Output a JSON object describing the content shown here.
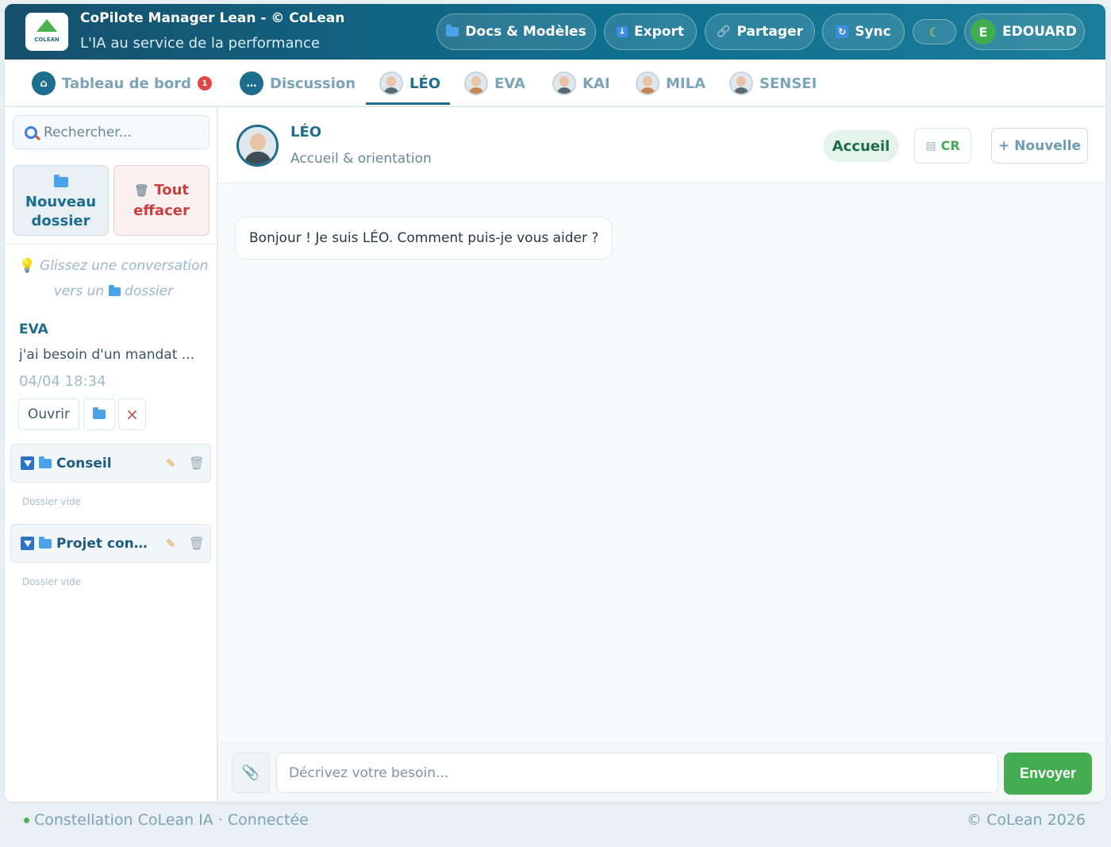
{
  "header": {
    "logo_text": "COLEAN",
    "title": "CoPilote Manager Lean - © CoLean",
    "subtitle": "L'IA au service de la performance",
    "buttons": {
      "docs": "Docs & Modèles",
      "export": "Export",
      "share": "Partager",
      "sync": "Sync",
      "theme_icon": "moon-icon",
      "user_initial": "E",
      "user_name": "EDOUARD"
    }
  },
  "tabs": [
    {
      "label": "Tableau de bord",
      "badge": "1",
      "icon": "home-icon"
    },
    {
      "label": "Discussion",
      "icon": "chat-bubble-icon"
    },
    {
      "label": "LÉO",
      "icon": "avatar",
      "active": true
    },
    {
      "label": "EVA",
      "icon": "avatar"
    },
    {
      "label": "KAI",
      "icon": "avatar"
    },
    {
      "label": "MILA",
      "icon": "avatar"
    },
    {
      "label": "SENSEI",
      "icon": "avatar"
    }
  ],
  "sidebar": {
    "search_placeholder": "Rechercher...",
    "new_folder": "Nouveau dossier",
    "clear_all": "Tout effacer",
    "hint_part1": "Glissez une conversation vers un",
    "hint_part2": "dossier",
    "conversation": {
      "agent": "EVA",
      "snippet": "j'ai besoin d'un mandat ...",
      "date": "04/04 18:34",
      "open": "Ouvrir"
    },
    "folders": [
      {
        "name": "Conseil",
        "empty": "Dossier vide"
      },
      {
        "name": "Projet conc...",
        "empty": "Dossier vide"
      }
    ]
  },
  "chat": {
    "agent_name": "LÉO",
    "agent_role": "Accueil & orientation",
    "mode_pill": "Accueil",
    "cr_label": "CR",
    "new_label": "+ Nouvelle",
    "messages": [
      {
        "from": "LÉO",
        "text": "Bonjour ! Je suis LÉO. Comment puis-je vous aider ?"
      }
    ],
    "input_placeholder": "Décrivez votre besoin...",
    "send_label": "Envoyer"
  },
  "footer": {
    "status": "Constellation CoLean IA · Connectée",
    "copyright": "© CoLean 2026"
  },
  "colors": {
    "header_gradient_start": "#16506d",
    "accent": "#1c6d8e",
    "send_green": "#44ad52",
    "badge_red": "#e04848",
    "danger": "#c84040"
  }
}
